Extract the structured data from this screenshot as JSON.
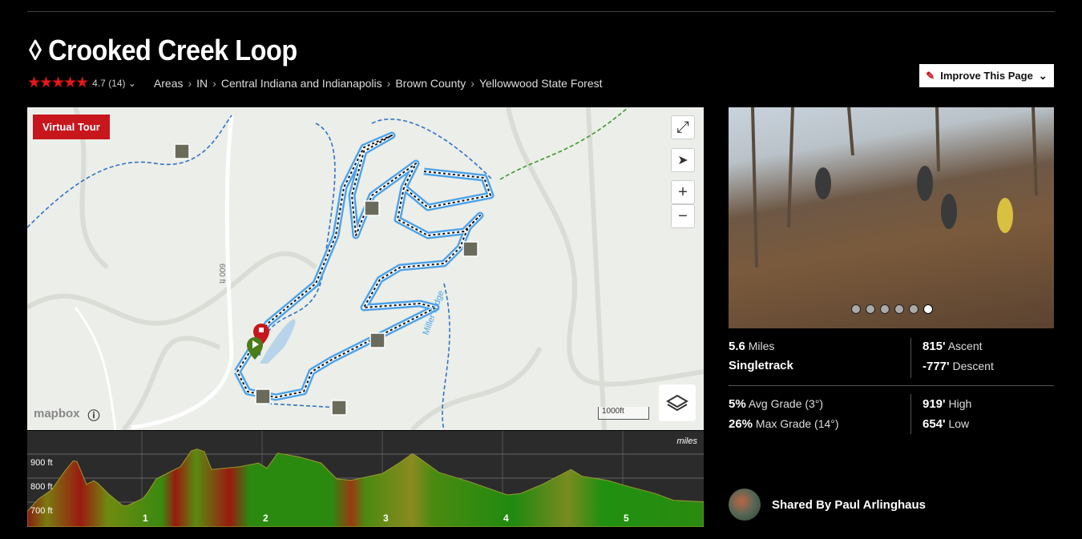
{
  "title": "◊ Crooked Creek Loop",
  "rating": {
    "stars": 4.7,
    "label": "4.7 (14)",
    "stars_text": "★★★★★"
  },
  "breadcrumbs": [
    "Areas",
    "IN",
    "Central Indiana and Indianapolis",
    "Brown County",
    "Yellowwood State Forest"
  ],
  "improve_button": "Improve This Page",
  "map": {
    "virtual_tour": "Virtual Tour",
    "scale": "1000ft",
    "attribution": "mapbox",
    "road_label": "600 ft",
    "ridge_label": "Miller Ridge",
    "trail_color": "#4da3e8"
  },
  "photo": {
    "slides": 6,
    "active": 6
  },
  "stats": {
    "miles_value": "5.6",
    "miles_label": "Miles",
    "type": "Singletrack",
    "ascent_value": "815'",
    "ascent_label": "Ascent",
    "descent_value": "-777'",
    "descent_label": "Descent",
    "avg_value": "5%",
    "avg_label": "Avg Grade (3°)",
    "max_value": "26%",
    "max_label": "Max Grade (14°)",
    "high_value": "919'",
    "high_label": "High",
    "low_value": "654'",
    "low_label": "Low"
  },
  "shared_by": "Shared By Paul Arlinghaus",
  "elevation": {
    "unit_label": "miles",
    "y_ticks": [
      "900 ft",
      "800 ft",
      "700 ft"
    ],
    "x_ticks": [
      "1",
      "2",
      "3",
      "4",
      "5"
    ],
    "profile": [
      [
        0.04,
        658
      ],
      [
        0.14,
        713
      ],
      [
        0.25,
        752
      ],
      [
        0.36,
        830
      ],
      [
        0.43,
        872
      ],
      [
        0.46,
        869
      ],
      [
        0.54,
        774
      ],
      [
        0.6,
        789
      ],
      [
        0.63,
        780
      ],
      [
        0.72,
        736
      ],
      [
        0.84,
        686
      ],
      [
        0.88,
        686
      ],
      [
        1.01,
        716
      ],
      [
        1.05,
        741
      ],
      [
        1.12,
        797
      ],
      [
        1.25,
        830
      ],
      [
        1.32,
        847
      ],
      [
        1.41,
        913
      ],
      [
        1.46,
        921
      ],
      [
        1.52,
        910
      ],
      [
        1.58,
        836
      ],
      [
        1.81,
        847
      ],
      [
        1.97,
        863
      ],
      [
        2.04,
        841
      ],
      [
        2.13,
        904
      ],
      [
        2.31,
        888
      ],
      [
        2.49,
        863
      ],
      [
        2.62,
        797
      ],
      [
        2.74,
        791
      ],
      [
        3.0,
        819
      ],
      [
        3.14,
        863
      ],
      [
        3.25,
        902
      ],
      [
        3.3,
        886
      ],
      [
        3.47,
        824
      ],
      [
        3.72,
        786
      ],
      [
        4.04,
        730
      ],
      [
        4.15,
        736
      ],
      [
        4.33,
        774
      ],
      [
        4.57,
        836
      ],
      [
        4.66,
        808
      ],
      [
        4.87,
        791
      ],
      [
        5.02,
        769
      ],
      [
        5.27,
        736
      ],
      [
        5.42,
        708
      ],
      [
        5.65,
        702
      ]
    ]
  }
}
